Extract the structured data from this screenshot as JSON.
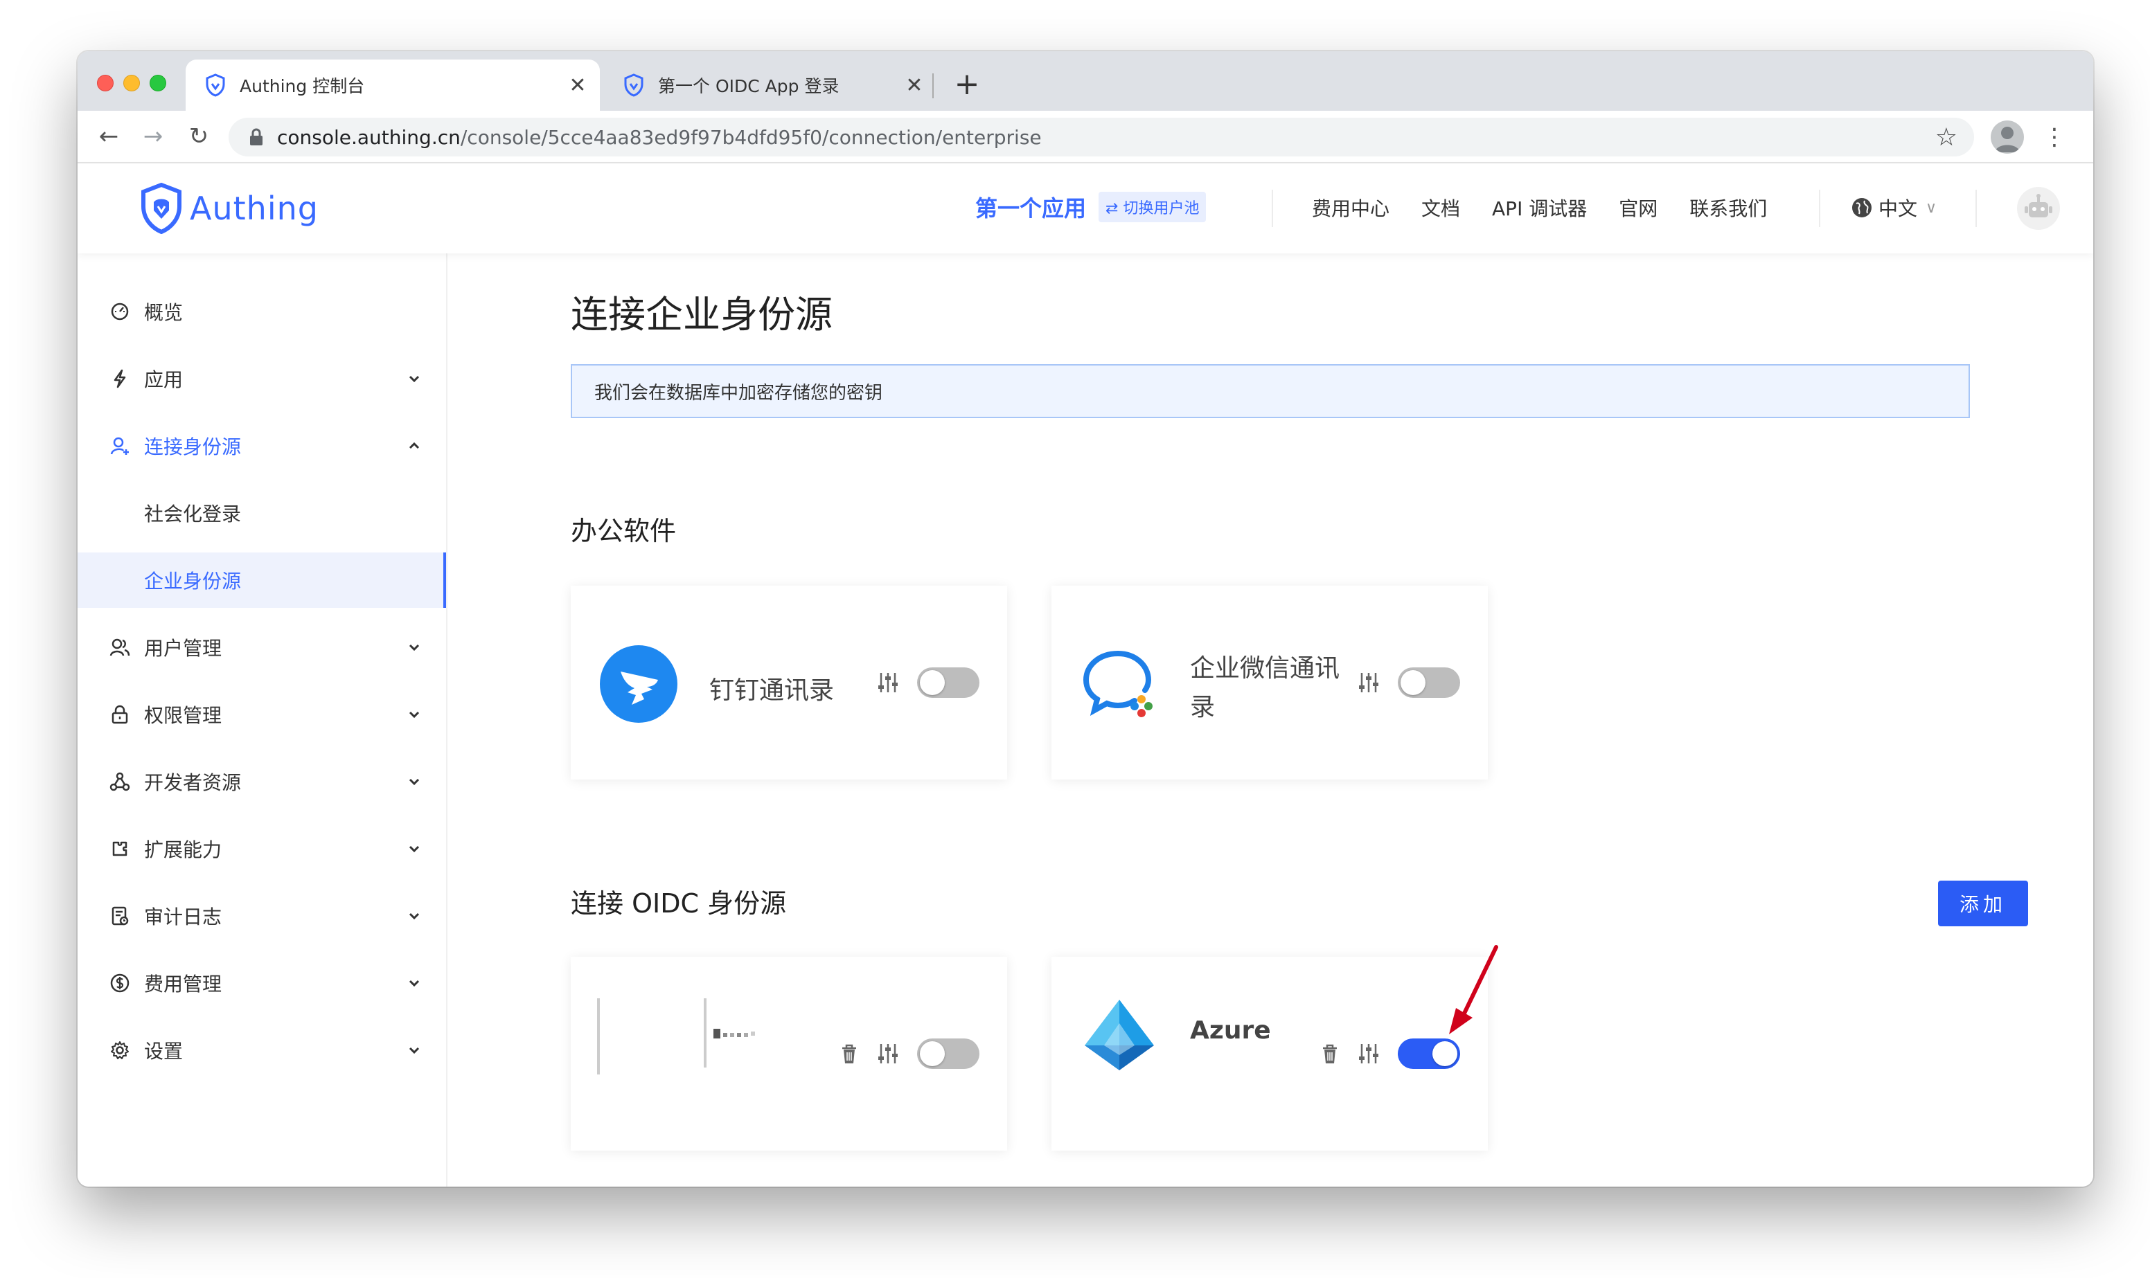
{
  "browser": {
    "tabs": [
      {
        "title": "Authing 控制台",
        "close": "✕"
      },
      {
        "title": "第一个 OIDC App 登录",
        "close": "✕"
      }
    ],
    "new_tab": "+",
    "url_host": "console.authing.cn",
    "url_path": "/console/5cce4aa83ed9f97b4dfd95f0/connection/enterprise",
    "back": "←",
    "forward": "→",
    "reload": "↻",
    "bookmark": "☆",
    "menu": "⋮"
  },
  "header": {
    "brand": "Authing",
    "app_name": "第一个应用",
    "switch_pool": "⇄ 切换用户池",
    "nav": [
      "费用中心",
      "文档",
      "API 调试器",
      "官网",
      "联系我们"
    ],
    "language": "中文",
    "language_chevron": "∨"
  },
  "sidebar": {
    "items": [
      {
        "label": "概览"
      },
      {
        "label": "应用"
      },
      {
        "label": "连接身份源"
      },
      {
        "label": "社会化登录"
      },
      {
        "label": "企业身份源"
      },
      {
        "label": "用户管理"
      },
      {
        "label": "权限管理"
      },
      {
        "label": "开发者资源"
      },
      {
        "label": "扩展能力"
      },
      {
        "label": "审计日志"
      },
      {
        "label": "费用管理"
      },
      {
        "label": "设置"
      }
    ]
  },
  "main": {
    "title": "连接企业身份源",
    "notice": "我们会在数据库中加密存储您的密钥",
    "office_section": "办公软件",
    "office_cards": [
      {
        "name": "钉钉通讯录",
        "enabled": false
      },
      {
        "name_line1": "企业微信通讯",
        "name_line2": "录",
        "enabled": false
      }
    ],
    "oidc_section": "连接 OIDC 身份源",
    "add_button": "添加",
    "oidc_cards": [
      {
        "name": "",
        "enabled": false
      },
      {
        "name": "Azure",
        "enabled": true
      }
    ]
  },
  "colors": {
    "accent": "#396aff",
    "toggle_on": "#2b5cf5",
    "toggle_off": "#bdbdbd",
    "arrow": "#d0021b"
  }
}
